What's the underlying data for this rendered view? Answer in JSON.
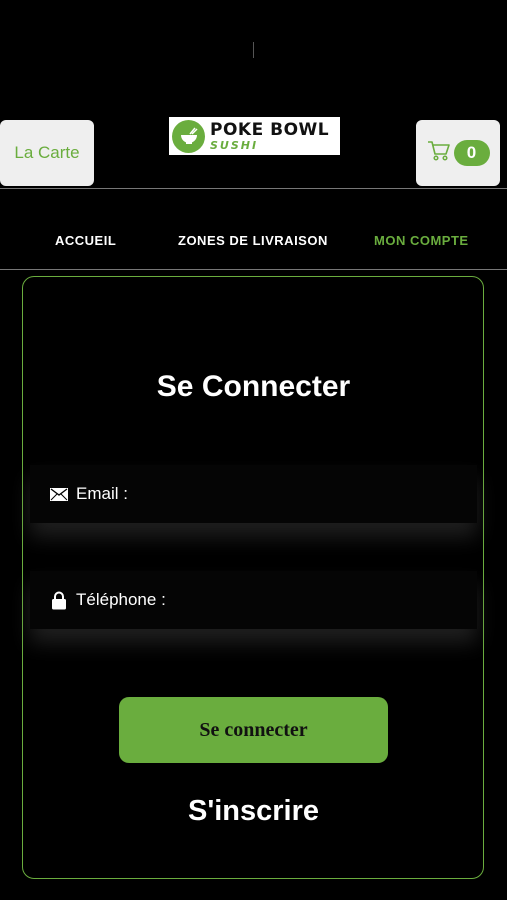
{
  "header": {
    "menu_label": "La Carte",
    "logo_title": "POKE BOWL",
    "logo_subtitle": "SUSHI",
    "cart_count": "0"
  },
  "nav": {
    "items": [
      {
        "label": "ACCUEIL",
        "active": false
      },
      {
        "label": "ZONES DE LIVRAISON",
        "active": false
      },
      {
        "label": "MON COMPTE",
        "active": true
      }
    ]
  },
  "login": {
    "title": "Se Connecter",
    "email_label": "Email :",
    "phone_label": "Téléphone :",
    "submit_label": "Se connecter",
    "register_label": "S'inscrire"
  },
  "colors": {
    "accent": "#6aad3e",
    "background": "#000000",
    "button_light": "#efefef"
  },
  "icons": [
    "cart-icon",
    "envelope-icon",
    "lock-icon",
    "bowl-logo-icon"
  ]
}
